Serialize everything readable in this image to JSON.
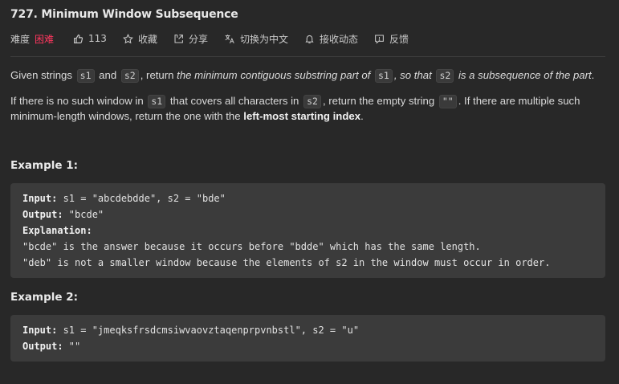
{
  "problem": {
    "title": "727. Minimum Window Subsequence"
  },
  "meta": {
    "difficulty_label": "难度",
    "difficulty_value": "困难",
    "likes": "113",
    "favorite": "收藏",
    "share": "分享",
    "switch_lang": "切换为中文",
    "notify": "接收动态",
    "feedback": "反馈",
    "difficulty_color": "#ff375f"
  },
  "description": {
    "p1_a": "Given strings",
    "p1_s1": "s1",
    "p1_and": "and",
    "p1_s2": "s2",
    "p1_b": ", return",
    "p1_em1": "the minimum contiguous substring part of",
    "p1_s1b": "s1",
    "p1_em2": ", so that",
    "p1_s2b": "s2",
    "p1_em3": "is a subsequence of the part",
    "p1_end": ".",
    "p2_a": "If there is no such window in",
    "p2_s1": "s1",
    "p2_b": "that covers all characters in",
    "p2_s2": "s2",
    "p2_c": ", return the empty string",
    "p2_empty": "\"\"",
    "p2_d": ". If there are multiple such minimum-length windows, return the one with the",
    "p2_strong": "left-most starting index",
    "p2_end": "."
  },
  "examples": [
    {
      "title": "Example 1:",
      "input_label": "Input:",
      "input_value": " s1 = \"abcdebdde\", s2 = \"bde\"",
      "output_label": "Output:",
      "output_value": " \"bcde\"",
      "explanation_label": "Explanation:",
      "explanation_line1": "\"bcde\" is the answer because it occurs before \"bdde\" which has the same length.",
      "explanation_line2": "\"deb\" is not a smaller window because the elements of s2 in the window must occur in order."
    },
    {
      "title": "Example 2:",
      "input_label": "Input:",
      "input_value": " s1 = \"jmeqksfrsdcmsiwvaovztaqenprpvnbstl\", s2 = \"u\"",
      "output_label": "Output:",
      "output_value": " \"\""
    }
  ]
}
